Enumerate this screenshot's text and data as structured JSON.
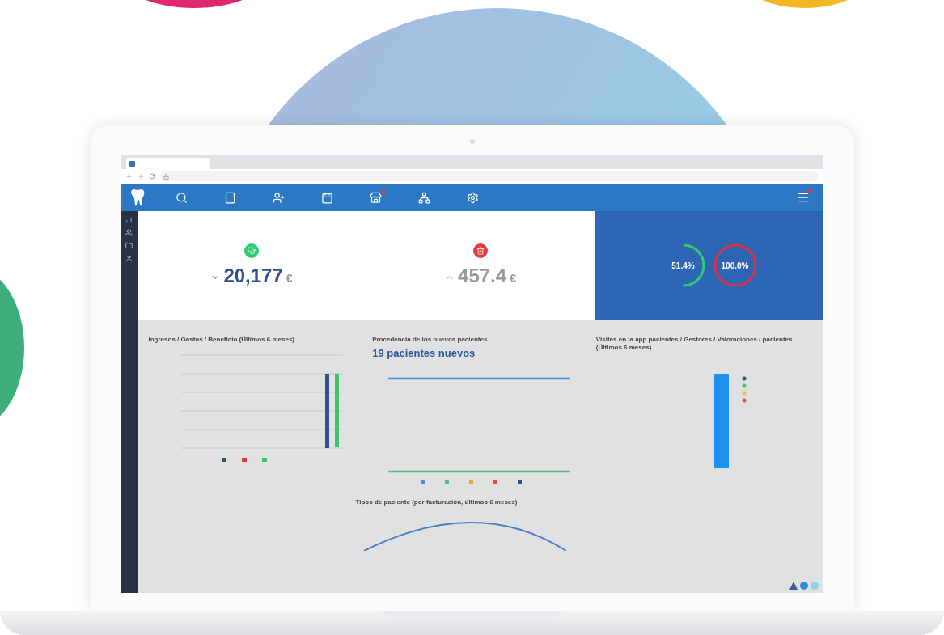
{
  "stats": [
    {
      "kind": "down",
      "value": "20,177",
      "unit": "€",
      "color": "#2ecc71"
    },
    {
      "kind": "up",
      "value": "457.4",
      "unit": "€",
      "color": "#e03a3a"
    }
  ],
  "ratios": [
    {
      "value": "51.4%",
      "color": "#2ecc71",
      "level": 0.5
    },
    {
      "value": "100.0%",
      "color": "#d6334a",
      "level": 1
    }
  ],
  "charts": [
    {
      "kind": "bars",
      "title": "Ingresos / Gastos / Beneficio (Últimos 6 meses)"
    },
    {
      "kind": "lines",
      "title": "Procedencia de los nuevos pacientes",
      "headline": "19 pacientes nuevos"
    },
    {
      "kind": "stack",
      "title": "Visitas en la app pacientes / Gestores / Valoraciones / pacientes (Últimos 6 meses)"
    }
  ],
  "bottom_chart": {
    "title": "Tipos de paciente (por facturación, últimos 6 meses)"
  }
}
